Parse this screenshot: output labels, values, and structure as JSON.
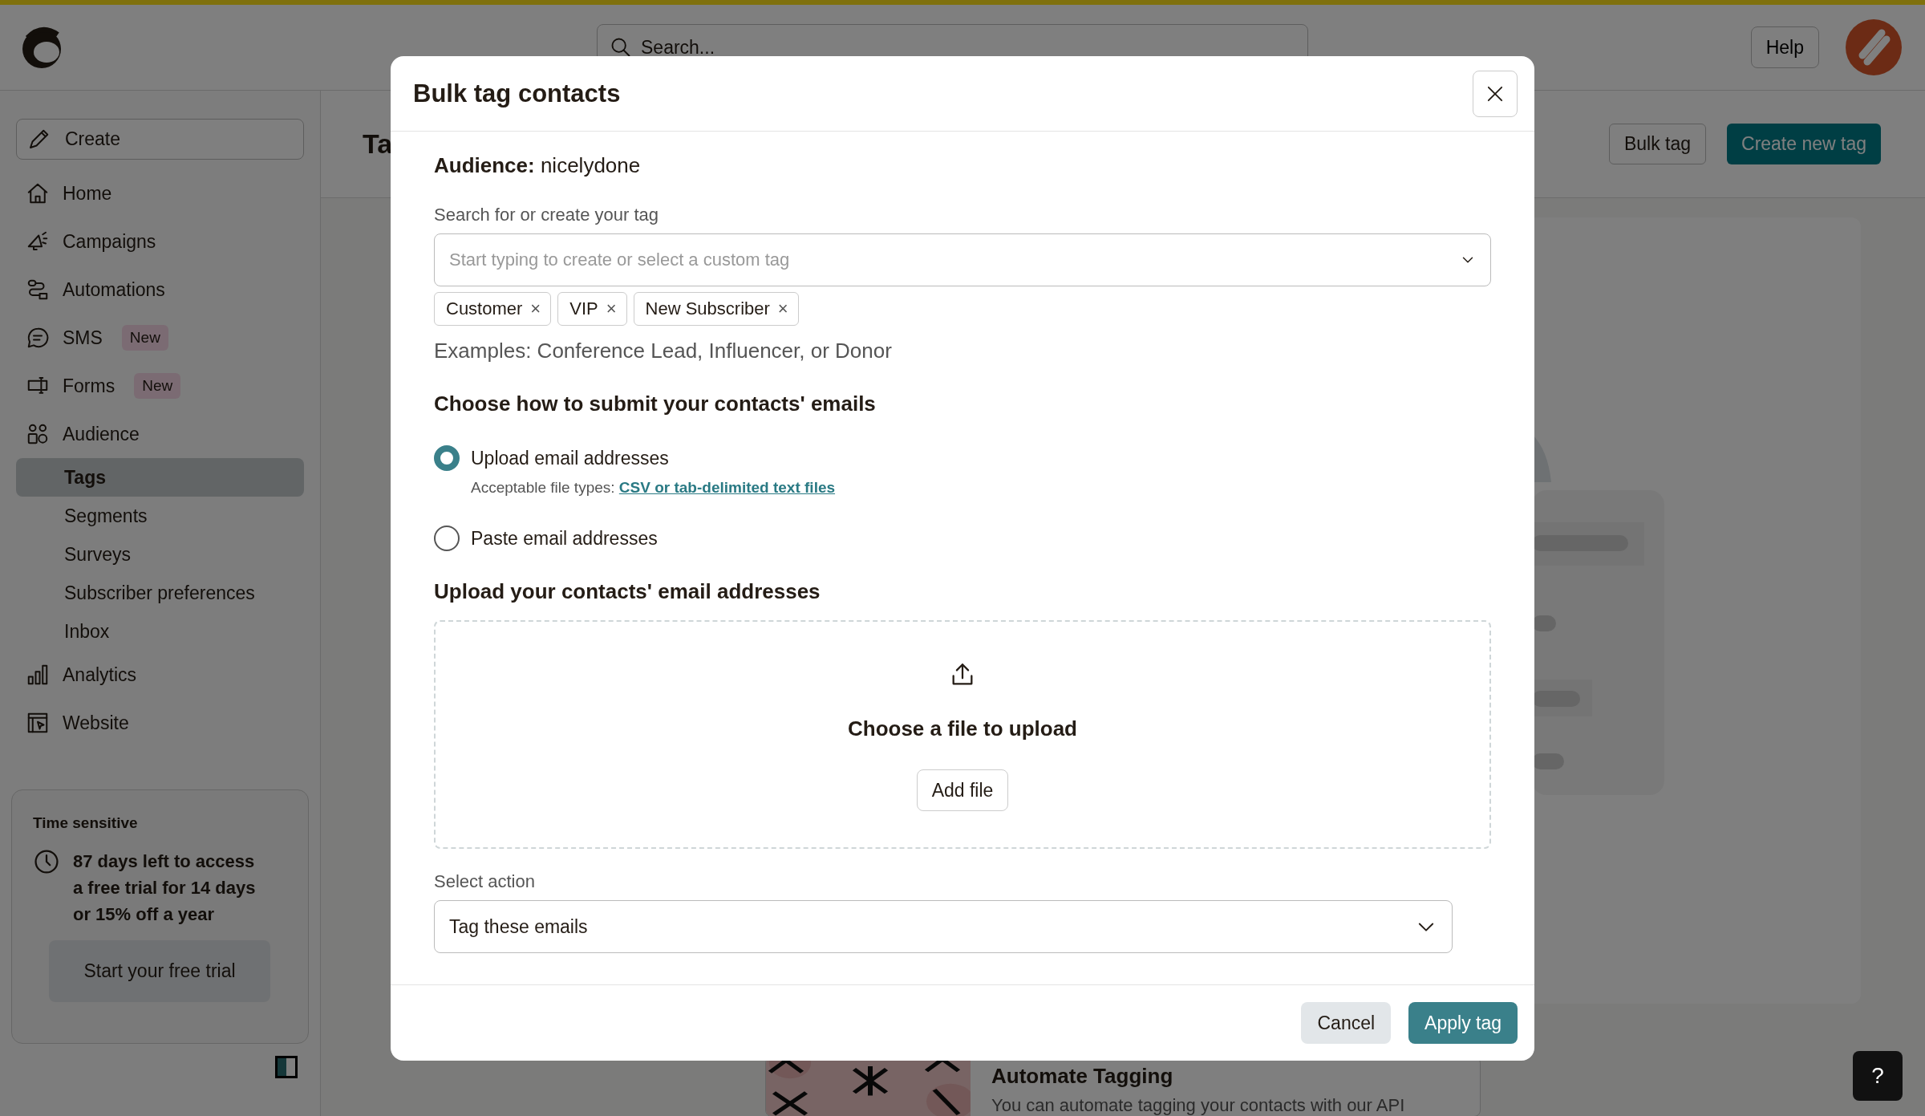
{
  "top_bar": {
    "search": {
      "placeholder": "Search..."
    },
    "help_button": "Help"
  },
  "sidebar": {
    "create_button": "Create",
    "items": [
      {
        "label": "Home",
        "kind": "home",
        "selected": false
      },
      {
        "label": "Campaigns",
        "kind": "campaigns",
        "selected": false
      },
      {
        "label": "Automations",
        "kind": "automations",
        "selected": false
      },
      {
        "label": "SMS",
        "kind": "sms",
        "badge": "New",
        "selected": false
      },
      {
        "label": "Forms",
        "kind": "forms",
        "badge": "New",
        "selected": false
      },
      {
        "label": "Audience",
        "kind": "audience",
        "selected": false,
        "children": [
          {
            "label": "Tags",
            "selected": true
          },
          {
            "label": "Segments",
            "selected": false
          },
          {
            "label": "Surveys",
            "selected": false
          },
          {
            "label": "Subscriber preferences",
            "selected": false
          },
          {
            "label": "Inbox",
            "selected": false
          }
        ]
      },
      {
        "label": "Analytics",
        "kind": "analytics",
        "selected": false
      },
      {
        "label": "Website",
        "kind": "website",
        "selected": false
      }
    ],
    "trial_card": {
      "label": "Time sensitive",
      "message": "87 days left to access a free trial for 14 days or 15% off a year",
      "button": "Start your free trial"
    }
  },
  "page": {
    "title": "Ta",
    "buttons": [
      {
        "label": "Bulk tag",
        "kind": "secondary"
      },
      {
        "label": "Create new tag",
        "kind": "primary"
      }
    ],
    "promo": {
      "title": "Automate Tagging",
      "text": "You can automate tagging your contacts with our API"
    },
    "help_fab": "?"
  },
  "modal": {
    "title": "Bulk tag contacts",
    "audience": "**Audience:** nicelydone",
    "tag_field": {
      "label": "Search for or create your tag",
      "placeholder": "Start typing to create or select a custom tag"
    },
    "tags": [
      {
        "label": "Customer",
        "remove": "×"
      },
      {
        "label": "VIP",
        "remove": "×"
      },
      {
        "label": "New Subscriber",
        "remove": "×"
      }
    ],
    "examples": "Examples: Conference Lead, Influencer, or Donor",
    "submit_heading": "Choose how to submit your contacts' emails",
    "options": [
      {
        "label": "Upload email addresses",
        "selected": true,
        "hint": "Acceptable file types:",
        "hint_link": "CSV or tab-delimited text files"
      },
      {
        "label": "Paste email addresses",
        "selected": false
      }
    ],
    "upload_heading": "Upload your contacts' email addresses",
    "dropzone": {
      "text": "Choose a file to upload",
      "button": "Add file"
    },
    "action_field": {
      "label": "Select action",
      "value": "Tag these emails"
    },
    "buttons": [
      {
        "label": "Cancel",
        "kind": "secondary"
      },
      {
        "label": "Apply tag",
        "kind": "primary"
      }
    ]
  }
}
